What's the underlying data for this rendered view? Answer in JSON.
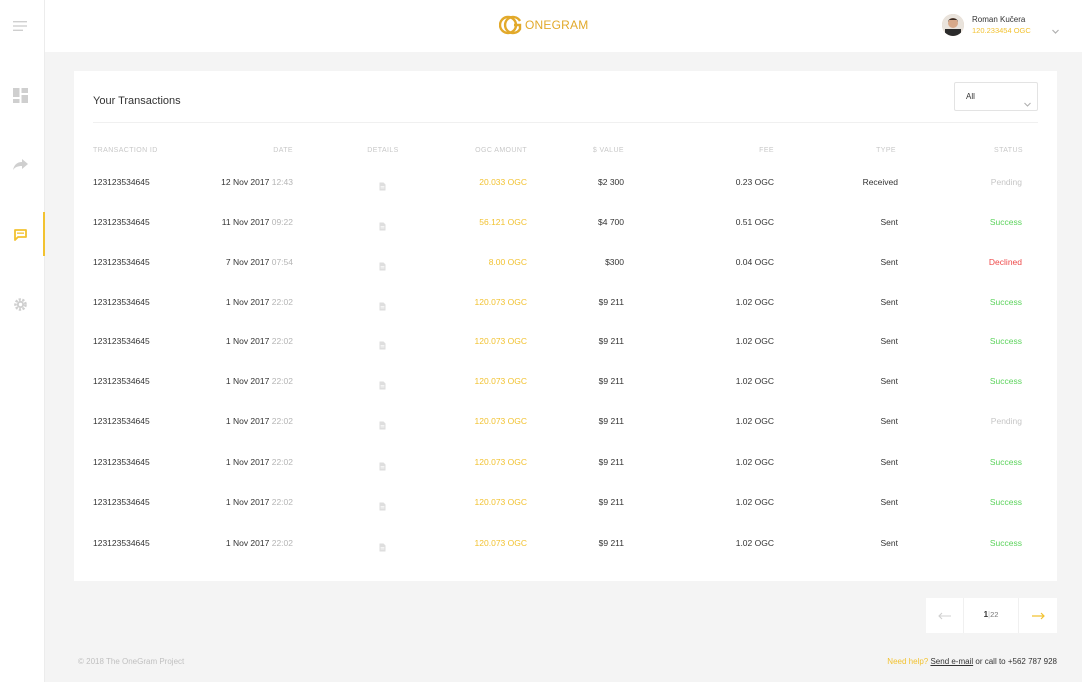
{
  "header": {
    "logo_text": "ONEGRAM",
    "user_name": "Roman Kučera",
    "user_balance": "120.233454 OGC"
  },
  "sidebar": {
    "items": [
      {
        "icon": "menu-icon"
      },
      {
        "icon": "dashboard-icon"
      },
      {
        "icon": "send-icon"
      },
      {
        "icon": "transactions-icon",
        "active": true
      },
      {
        "icon": "settings-icon"
      }
    ]
  },
  "transactions": {
    "title": "Your Transactions",
    "filter_value": "All",
    "columns": [
      "TRANSACTION ID",
      "DATE",
      "DETAILS",
      "OGC AMOUNT",
      "$ VALUE",
      "FEE",
      "TYPE",
      "STATUS"
    ],
    "rows": [
      {
        "id": "123123534645",
        "date": "12 Nov 2017",
        "time": "12:43",
        "amount": "20.033 OGC",
        "value": "$2 300",
        "fee": "0.23 OGC",
        "type": "Received",
        "status": "Pending"
      },
      {
        "id": "123123534645",
        "date": "11 Nov 2017",
        "time": "09:22",
        "amount": "56.121 OGC",
        "value": "$4 700",
        "fee": "0.51 OGC",
        "type": "Sent",
        "status": "Success"
      },
      {
        "id": "123123534645",
        "date": "7 Nov 2017",
        "time": "07:54",
        "amount": "8.00 OGC",
        "value": "$300",
        "fee": "0.04 OGC",
        "type": "Sent",
        "status": "Declined"
      },
      {
        "id": "123123534645",
        "date": "1 Nov 2017",
        "time": "22:02",
        "amount": "120.073 OGC",
        "value": "$9 211",
        "fee": "1.02 OGC",
        "type": "Sent",
        "status": "Success"
      },
      {
        "id": "123123534645",
        "date": "1 Nov 2017",
        "time": "22:02",
        "amount": "120.073 OGC",
        "value": "$9 211",
        "fee": "1.02 OGC",
        "type": "Sent",
        "status": "Success"
      },
      {
        "id": "123123534645",
        "date": "1 Nov 2017",
        "time": "22:02",
        "amount": "120.073 OGC",
        "value": "$9 211",
        "fee": "1.02 OGC",
        "type": "Sent",
        "status": "Success"
      },
      {
        "id": "123123534645",
        "date": "1 Nov 2017",
        "time": "22:02",
        "amount": "120.073 OGC",
        "value": "$9 211",
        "fee": "1.02 OGC",
        "type": "Sent",
        "status": "Pending"
      },
      {
        "id": "123123534645",
        "date": "1 Nov 2017",
        "time": "22:02",
        "amount": "120.073 OGC",
        "value": "$9 211",
        "fee": "1.02 OGC",
        "type": "Sent",
        "status": "Success"
      },
      {
        "id": "123123534645",
        "date": "1 Nov 2017",
        "time": "22:02",
        "amount": "120.073 OGC",
        "value": "$9 211",
        "fee": "1.02 OGC",
        "type": "Sent",
        "status": "Success"
      },
      {
        "id": "123123534645",
        "date": "1 Nov 2017",
        "time": "22:02",
        "amount": "120.073 OGC",
        "value": "$9 211",
        "fee": "1.02 OGC",
        "type": "Sent",
        "status": "Success"
      }
    ]
  },
  "pagination": {
    "current": "1",
    "separator": "|",
    "total": "22"
  },
  "footer": {
    "copyright": "© 2018 The OneGram Project",
    "help_label": "Need help?",
    "email_link": "Send e-mail",
    "call_text": "or call to +562 787 928"
  },
  "colors": {
    "accent": "#f2c230",
    "success": "#5cd35c",
    "declined": "#ee4a4a",
    "pending": "#c6c6c6"
  }
}
